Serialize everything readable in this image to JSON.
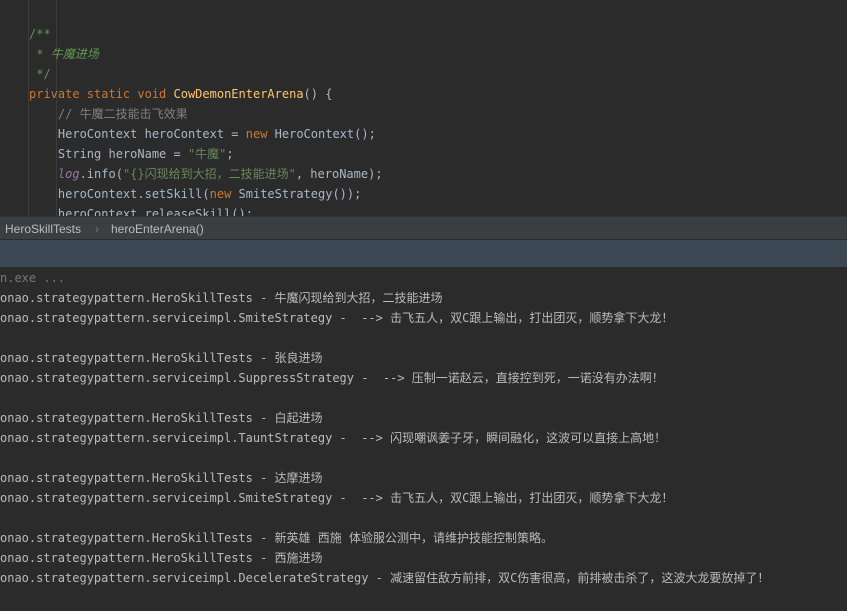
{
  "editor": {
    "lines": [
      {
        "segments": [
          {
            "cls": "t-doc",
            "text": "/**"
          }
        ]
      },
      {
        "segments": [
          {
            "cls": "t-doc",
            "text": " * "
          },
          {
            "cls": "t-docit",
            "text": "牛魔进场"
          }
        ]
      },
      {
        "segments": [
          {
            "cls": "t-doc",
            "text": " */"
          }
        ]
      },
      {
        "segments": [
          {
            "cls": "t-kw",
            "text": "private static void "
          },
          {
            "cls": "t-fn",
            "text": "CowDemonEnterArena"
          },
          {
            "cls": "t-txt",
            "text": "() {"
          }
        ]
      },
      {
        "segments": [
          {
            "cls": "t-cm",
            "text": "    // 牛魔二技能击飞效果"
          }
        ]
      },
      {
        "segments": [
          {
            "cls": "t-txt",
            "text": "    HeroContext heroContext = "
          },
          {
            "cls": "t-kw",
            "text": "new "
          },
          {
            "cls": "t-txt",
            "text": "HeroContext();"
          }
        ]
      },
      {
        "segments": [
          {
            "cls": "t-txt",
            "text": "    String heroName = "
          },
          {
            "cls": "t-str",
            "text": "\"牛魔\""
          },
          {
            "cls": "t-txt",
            "text": ";"
          }
        ]
      },
      {
        "segments": [
          {
            "cls": "t-log",
            "text": "    log"
          },
          {
            "cls": "t-txt",
            "text": ".info("
          },
          {
            "cls": "t-str",
            "text": "\"{}闪现给到大招，二技能进场\""
          },
          {
            "cls": "t-txt",
            "text": ", heroName);"
          }
        ]
      },
      {
        "segments": [
          {
            "cls": "t-txt",
            "text": "    heroContext.setSkill("
          },
          {
            "cls": "t-kw",
            "text": "new "
          },
          {
            "cls": "t-txt",
            "text": "SmiteStrategy());"
          }
        ]
      },
      {
        "segments": [
          {
            "cls": "t-txt",
            "text": "    heroContext.releaseSkill();"
          }
        ]
      }
    ]
  },
  "breadcrumb": {
    "class_name": "HeroSkillTests",
    "separator": "›",
    "method_name": "heroEnterArena()"
  },
  "console": {
    "lines": [
      {
        "text": "n.exe ...",
        "dim": true
      },
      {
        "text": "onao.strategypattern.HeroSkillTests - 牛魔闪现给到大招，二技能进场"
      },
      {
        "text": "onao.strategypattern.serviceimpl.SmiteStrategy -  --> 击飞五人，双C跟上输出，打出团灭，顺势拿下大龙！"
      },
      {
        "text": ""
      },
      {
        "text": "onao.strategypattern.HeroSkillTests - 张良进场"
      },
      {
        "text": "onao.strategypattern.serviceimpl.SuppressStrategy -  --> 压制一诺赵云，直接控到死，一诺没有办法啊！"
      },
      {
        "text": ""
      },
      {
        "text": "onao.strategypattern.HeroSkillTests - 白起进场"
      },
      {
        "text": "onao.strategypattern.serviceimpl.TauntStrategy -  --> 闪现嘲讽姜子牙，瞬间融化，这波可以直接上高地！"
      },
      {
        "text": ""
      },
      {
        "text": "onao.strategypattern.HeroSkillTests - 达摩进场"
      },
      {
        "text": "onao.strategypattern.serviceimpl.SmiteStrategy -  --> 击飞五人，双C跟上输出，打出团灭，顺势拿下大龙！"
      },
      {
        "text": ""
      },
      {
        "text": "onao.strategypattern.HeroSkillTests - 新英雄 西施 体验服公测中，请维护技能控制策略。"
      },
      {
        "text": "onao.strategypattern.HeroSkillTests - 西施进场"
      },
      {
        "text": "onao.strategypattern.serviceimpl.DecelerateStrategy - 减速留住敌方前排，双C伤害很高，前排被击杀了，这波大龙要放掉了！"
      }
    ]
  },
  "colors": {
    "editor_bg": "#2b2b2b",
    "breadcrumb_bg": "#3c3f41",
    "run_strip_bg": "#3c4754",
    "keyword": "#cc7832",
    "function": "#ffc66d",
    "doc_comment": "#629755",
    "string": "#6a8759"
  }
}
